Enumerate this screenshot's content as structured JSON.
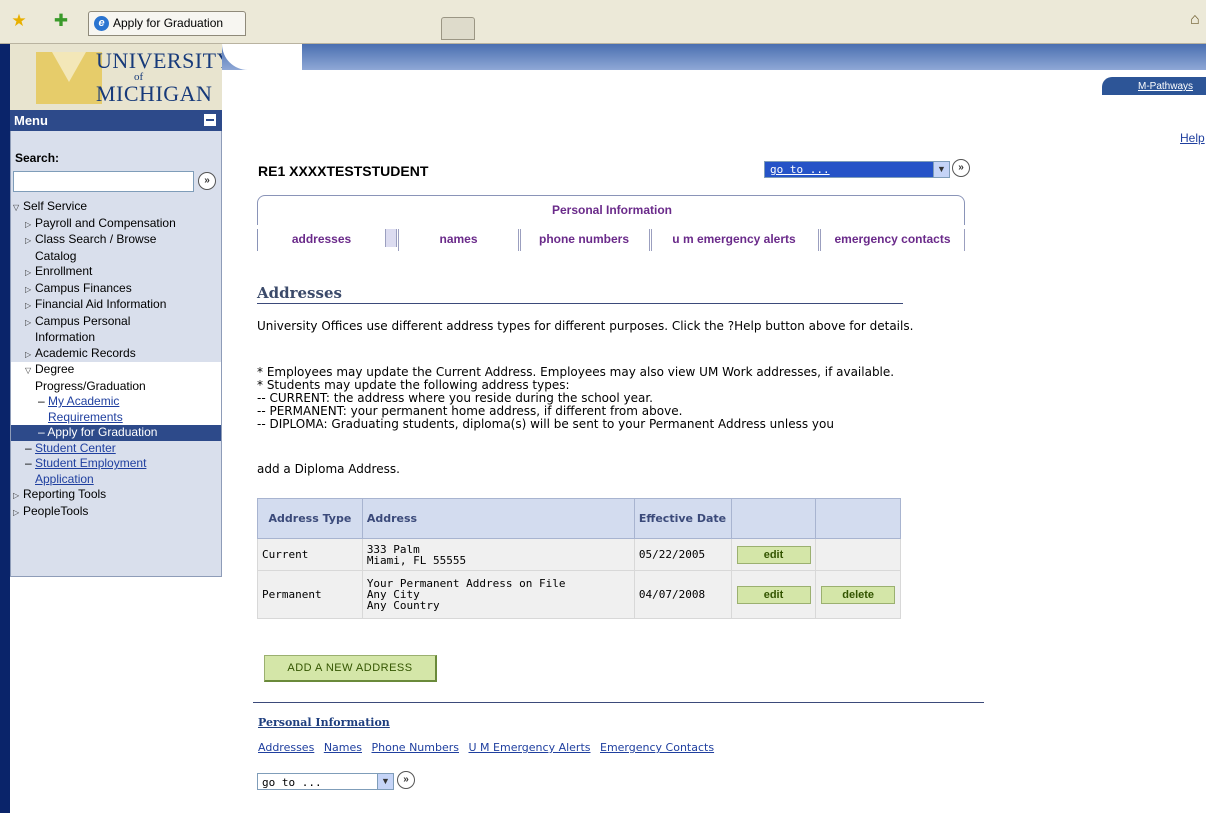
{
  "browser": {
    "tab_title": "Apply for Graduation",
    "ie_icon_letter": "e",
    "favorite_star": "★",
    "add_favorite_star": "✚",
    "home_glyph": "⌂"
  },
  "logo": {
    "line1": "UNIVERSITY",
    "line2": "of",
    "line3": "MICHIGAN"
  },
  "header": {
    "pathways_link": "M-Pathways",
    "help_link": "Help"
  },
  "menu": {
    "title": "Menu",
    "search_label": "Search:",
    "search_value": "",
    "go_glyph": "»",
    "items": [
      {
        "label": "Self Service",
        "level": 1,
        "icon": "triangle-down-icon"
      },
      {
        "label": "Payroll and Compensation",
        "level": 2,
        "icon": "triangle-right-icon"
      },
      {
        "label": "Class Search / Browse",
        "cont": "Catalog",
        "level": 2,
        "icon": "triangle-right-icon"
      },
      {
        "label": "Enrollment",
        "level": 2,
        "icon": "triangle-right-icon"
      },
      {
        "label": "Campus Finances",
        "level": 2,
        "icon": "triangle-right-icon"
      },
      {
        "label": "Financial Aid Information",
        "level": 2,
        "icon": "triangle-right-icon"
      },
      {
        "label": "Campus Personal",
        "cont": "Information",
        "level": 2,
        "icon": "triangle-right-icon"
      },
      {
        "label": "Academic Records",
        "level": 2,
        "icon": "triangle-right-icon"
      },
      {
        "label": "Degree",
        "cont": "Progress/Graduation",
        "level": 2,
        "icon": "triangle-down-icon"
      },
      {
        "label": "My Academic",
        "cont": "Requirements",
        "level": 3,
        "link": true
      },
      {
        "label": "Apply for Graduation",
        "level": 3,
        "selected": true
      },
      {
        "label": "Student Center",
        "level": 2,
        "link": true
      },
      {
        "label": "Student Employment",
        "cont": "Application",
        "level": 2,
        "link": true
      },
      {
        "label": "Reporting Tools",
        "level": 1,
        "icon": "triangle-right-icon"
      },
      {
        "label": "PeopleTools",
        "level": 1,
        "icon": "triangle-right-icon"
      }
    ]
  },
  "main": {
    "student_name": "RE1 XXXXTESTSTUDENT",
    "goto_label": "go to ...",
    "personal_info_title": "Personal Information",
    "tabs": [
      {
        "label": "addresses",
        "active": true
      },
      {
        "label": "names"
      },
      {
        "label": "phone numbers"
      },
      {
        "label": "u m emergency alerts"
      },
      {
        "label": "emergency contacts"
      }
    ],
    "section_title": "Addresses",
    "para1": "University Offices use different address types for different purposes. Click the ?Help button above for details.",
    "para2_lines": [
      "* Employees may update the Current Address. Employees may also view UM Work addresses, if available.",
      "* Students may update the following address types:",
      "-- CURRENT: the address where you reside during the school year.",
      "-- PERMANENT: your permanent home address, if different from above.",
      "-- DIPLOMA: Graduating students, diploma(s) will be sent to your Permanent Address unless you"
    ],
    "para3": "add a Diploma Address.",
    "table": {
      "headers": [
        "Address Type",
        "Address",
        "Effective Date",
        "",
        ""
      ],
      "rows": [
        {
          "type": "Current",
          "address": [
            "333 Palm",
            "Miami, FL 55555"
          ],
          "date": "05/22/2005",
          "edit": "edit",
          "delete": ""
        },
        {
          "type": "Permanent",
          "address": [
            "Your Permanent Address on File",
            "Any City",
            "Any Country"
          ],
          "date": "04/07/2008",
          "edit": "edit",
          "delete": "delete"
        }
      ]
    },
    "add_button": "ADD A NEW ADDRESS",
    "bottom_title": "Personal Information",
    "bottom_links": [
      "Addresses",
      "Names",
      "Phone Numbers",
      "U M Emergency Alerts",
      "Emergency Contacts"
    ],
    "bottom_goto": "go to ..."
  }
}
